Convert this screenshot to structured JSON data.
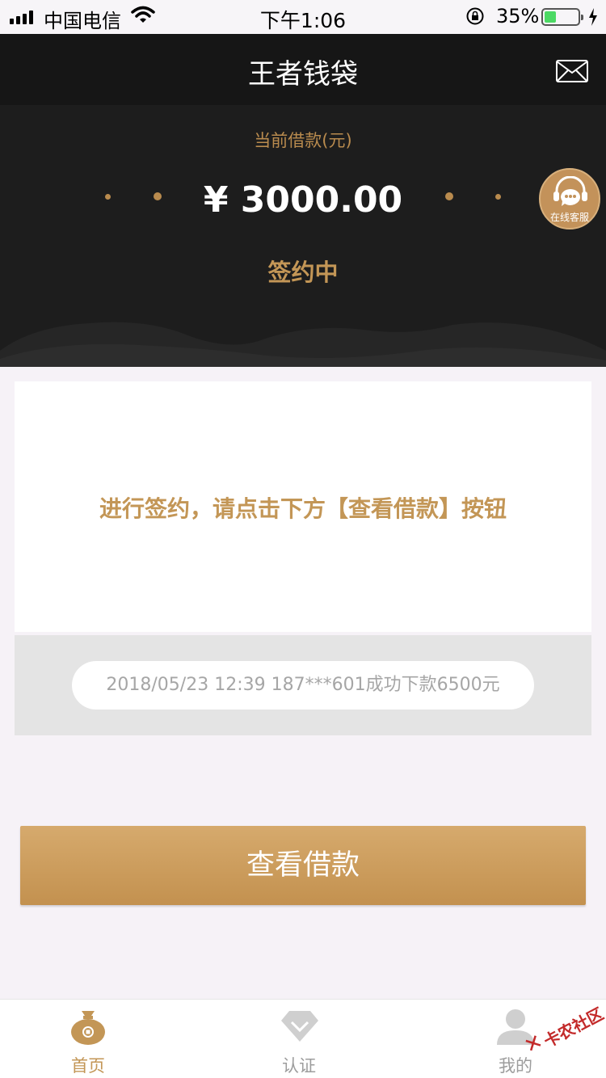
{
  "status_bar": {
    "carrier": "中国电信",
    "time": "下午1:06",
    "battery_percent_text": "35%",
    "battery_level": 0.35
  },
  "header": {
    "title": "王者钱袋",
    "mail_icon": "mail-icon"
  },
  "loan": {
    "label": "当前借款(元)",
    "amount": "¥ 3000.00",
    "status": "签约中"
  },
  "service": {
    "label": "在线客服",
    "icon": "headset-icon"
  },
  "notice": {
    "text": "进行签约，请点击下方【查看借款】按钮"
  },
  "ticker": {
    "text": "2018/05/23 12:39 187***601成功下款6500元"
  },
  "actions": {
    "view_loan_label": "查看借款"
  },
  "tabs": [
    {
      "label": "首页",
      "icon": "money-bag-icon",
      "active": true
    },
    {
      "label": "认证",
      "icon": "diamond-check-icon",
      "active": false
    },
    {
      "label": "我的",
      "icon": "user-icon",
      "active": false
    }
  ],
  "watermark": {
    "text": "卡农社区"
  },
  "colors": {
    "accent": "#c39656",
    "header_bg": "#1d1d1d",
    "nav_bg": "#161616"
  }
}
